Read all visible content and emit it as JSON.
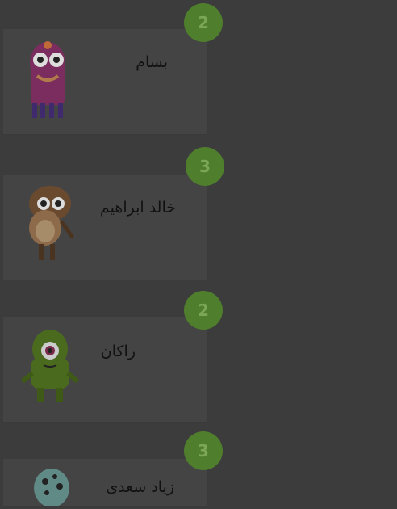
{
  "students": [
    {
      "points": "2",
      "name": "بسام",
      "avatar_icon": "pink-monster-avatar-icon"
    },
    {
      "points": "3",
      "name": "خالد ابراهيم",
      "avatar_icon": "hamster-monster-avatar-icon"
    },
    {
      "points": "2",
      "name": "راكان",
      "avatar_icon": "green-cyclops-monster-avatar-icon"
    },
    {
      "points": "3",
      "name": "زياد سعدى",
      "avatar_icon": "teal-monster-avatar-icon"
    }
  ],
  "colors": {
    "background": "#3c3c3c",
    "card": "#444444",
    "badge": "#4f7f2d",
    "badge_text": "#7aa655"
  }
}
